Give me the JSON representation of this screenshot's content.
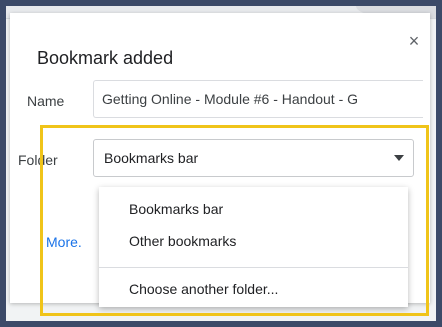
{
  "dialog": {
    "title": "Bookmark added",
    "close_label": "×",
    "name_label": "Name",
    "name_value": "Getting Online - Module #6 - Handout - G",
    "folder_label": "Folder",
    "folder_selected": "Bookmarks bar",
    "more_label": "More."
  },
  "dropdown": {
    "items": [
      "Bookmarks bar",
      "Other bookmarks",
      "Choose another folder..."
    ]
  },
  "colors": {
    "highlight": "#f0c419",
    "link": "#1a73e8"
  }
}
